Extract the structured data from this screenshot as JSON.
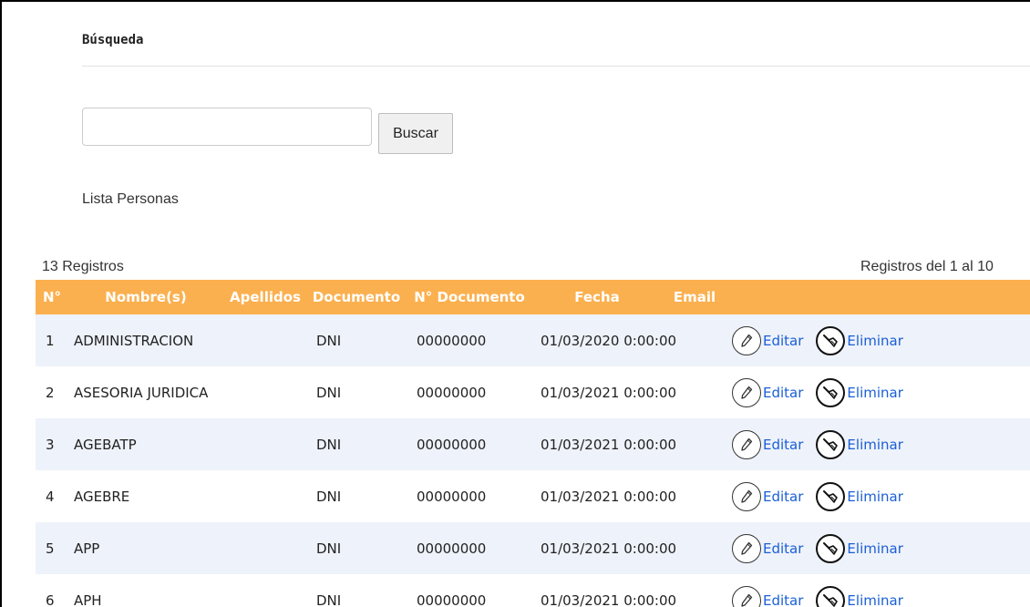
{
  "search": {
    "title": "Búsqueda",
    "input_value": "",
    "button_label": "Buscar"
  },
  "list": {
    "title": "Lista Personas",
    "records_count": "13  Registros",
    "records_range": "Registros del 1  al 10"
  },
  "table": {
    "headers": [
      "N°",
      "Nombre(s)",
      "Apellidos",
      "Documento",
      "N° Documento",
      "Fecha",
      "Email",
      ""
    ],
    "rows": [
      {
        "n": "1",
        "nombre": "ADMINISTRACION",
        "apellidos": "",
        "documento": "DNI",
        "nro": "00000000",
        "fecha": "01/03/2020 0:00:00",
        "email": ""
      },
      {
        "n": "2",
        "nombre": "ASESORIA JURIDICA",
        "apellidos": "",
        "documento": "DNI",
        "nro": "00000000",
        "fecha": "01/03/2021 0:00:00",
        "email": ""
      },
      {
        "n": "3",
        "nombre": "AGEBATP",
        "apellidos": "",
        "documento": "DNI",
        "nro": "00000000",
        "fecha": "01/03/2021 0:00:00",
        "email": ""
      },
      {
        "n": "4",
        "nombre": "AGEBRE",
        "apellidos": "",
        "documento": "DNI",
        "nro": "00000000",
        "fecha": "01/03/2021 0:00:00",
        "email": ""
      },
      {
        "n": "5",
        "nombre": "APP",
        "apellidos": "",
        "documento": "DNI",
        "nro": "00000000",
        "fecha": "01/03/2021 0:00:00",
        "email": ""
      },
      {
        "n": "6",
        "nombre": "APH",
        "apellidos": "",
        "documento": "DNI",
        "nro": "00000000",
        "fecha": "01/03/2021 0:00:00",
        "email": ""
      }
    ],
    "edit_label": "Editar",
    "delete_label": "Eliminar"
  },
  "colors": {
    "header_bg": "#fbb04f",
    "row_alt_bg": "#eef2fa",
    "link": "#1a5fd6"
  },
  "icons": {
    "edit": "pencil-icon",
    "delete": "broom-icon"
  }
}
